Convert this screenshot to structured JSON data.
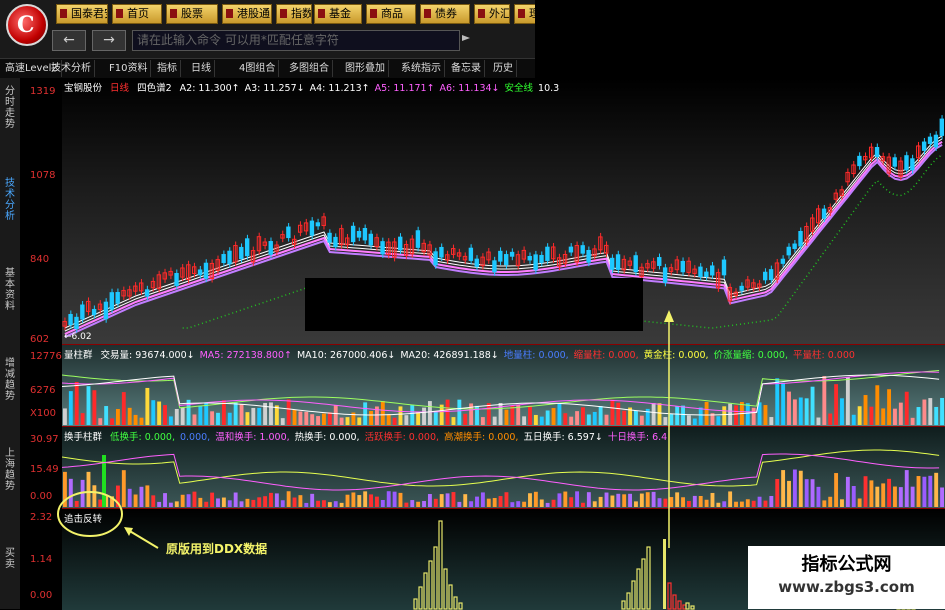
{
  "app": {
    "logo_text": "C"
  },
  "menu": [
    {
      "label": "国泰君安"
    },
    {
      "label": "首页"
    },
    {
      "label": "股票"
    },
    {
      "label": "港股通"
    },
    {
      "label": "指数"
    },
    {
      "label": "基金"
    },
    {
      "label": "商品"
    },
    {
      "label": "债券"
    },
    {
      "label": "外汇"
    },
    {
      "label": "理"
    }
  ],
  "nav": {
    "back_icon": "arrow-left-icon",
    "forward_icon": "arrow-right-icon",
    "command_placeholder": "请在此输入命令  可以用*匹配任意字符"
  },
  "toolbar": [
    {
      "label": "高速Level2"
    },
    {
      "label": "技术分析"
    },
    {
      "label": "F10资料"
    },
    {
      "label": "指标"
    },
    {
      "label": "日线"
    },
    {
      "label": "4图组合"
    },
    {
      "label": "多图组合"
    },
    {
      "label": "图形叠加"
    },
    {
      "label": "系统指示"
    },
    {
      "label": "备忘录"
    },
    {
      "label": "历史"
    }
  ],
  "left_tabs": [
    {
      "label": "分时走势",
      "active": false
    },
    {
      "label": "技术分析",
      "active": true
    },
    {
      "label": "基本资料",
      "active": false
    },
    {
      "label": "增减趋势",
      "active": false
    },
    {
      "label": "上海趋势",
      "active": false
    },
    {
      "label": "买卖",
      "active": false
    }
  ],
  "price_axis": [
    "1319",
    "1078",
    "840",
    "602"
  ],
  "price_low_label": "6.02",
  "main_indicator": {
    "stock": "宝钢股份",
    "period": "日线",
    "name": "四色谱2",
    "items": [
      {
        "text": "A2: 11.300↑",
        "color": "#ffffff"
      },
      {
        "text": "A3: 11.257↓",
        "color": "#ffffff"
      },
      {
        "text": "A4: 11.213↑",
        "color": "#ffffff"
      },
      {
        "text": "A5: 11.171↑",
        "color": "#ff60ff"
      },
      {
        "text": "A6: 11.134↓",
        "color": "#ff60ff"
      },
      {
        "text": "安全线",
        "color": "#30ff30"
      },
      {
        "text": "10.3",
        "color": "#ffffff"
      }
    ]
  },
  "volume_pane": {
    "axis": [
      "12776",
      "6276",
      "X100"
    ],
    "name": "量柱群",
    "items": [
      {
        "text": "交易量: 93674.000↓",
        "color": "#ffffff"
      },
      {
        "text": "MA5: 272138.800↑",
        "color": "#ff60ff"
      },
      {
        "text": "MA10: 267000.406↓",
        "color": "#ffffff"
      },
      {
        "text": "MA20: 426891.188↓",
        "color": "#ffffff"
      },
      {
        "text": "地量柱: 0.000,",
        "color": "#4a7dff"
      },
      {
        "text": "缩量柱: 0.000,",
        "color": "#ff3030"
      },
      {
        "text": "黄金柱: 0.000,",
        "color": "#ffff40"
      },
      {
        "text": "价涨量缩: 0.000,",
        "color": "#40ff40"
      },
      {
        "text": "平量柱: 0.000",
        "color": "#ff3030"
      }
    ]
  },
  "turnover_pane": {
    "axis": [
      "30.97",
      "15.49",
      "0.00"
    ],
    "name": "换手柱群",
    "items": [
      {
        "text": "低换手: 0.000,",
        "color": "#40ff40"
      },
      {
        "text": "0.000,",
        "color": "#4a7dff"
      },
      {
        "text": "温和换手: 1.000,",
        "color": "#ff60ff"
      },
      {
        "text": "热换手: 0.000,",
        "color": "#ffffff"
      },
      {
        "text": "活跃换手: 0.000,",
        "color": "#ff3030"
      },
      {
        "text": "高潮换手: 0.000,",
        "color": "#ff8c00"
      },
      {
        "text": "五日换手: 6.597↓",
        "color": "#ffffff"
      },
      {
        "text": "十日换手: 6.4",
        "color": "#ff60ff"
      }
    ]
  },
  "signal_pane": {
    "axis": [
      "2.32",
      "1.14",
      "0.00"
    ],
    "name": "追击反转",
    "annotation": "原版用到DDX数据"
  },
  "watermark": {
    "title": "指标公式网",
    "url": "www.zbgs3.com"
  },
  "colors": {
    "up": "#ff2a2a",
    "down": "#1ec8ff",
    "ma": "#d27bff",
    "safety": "#22c022",
    "annotation": "#f3f36a"
  }
}
